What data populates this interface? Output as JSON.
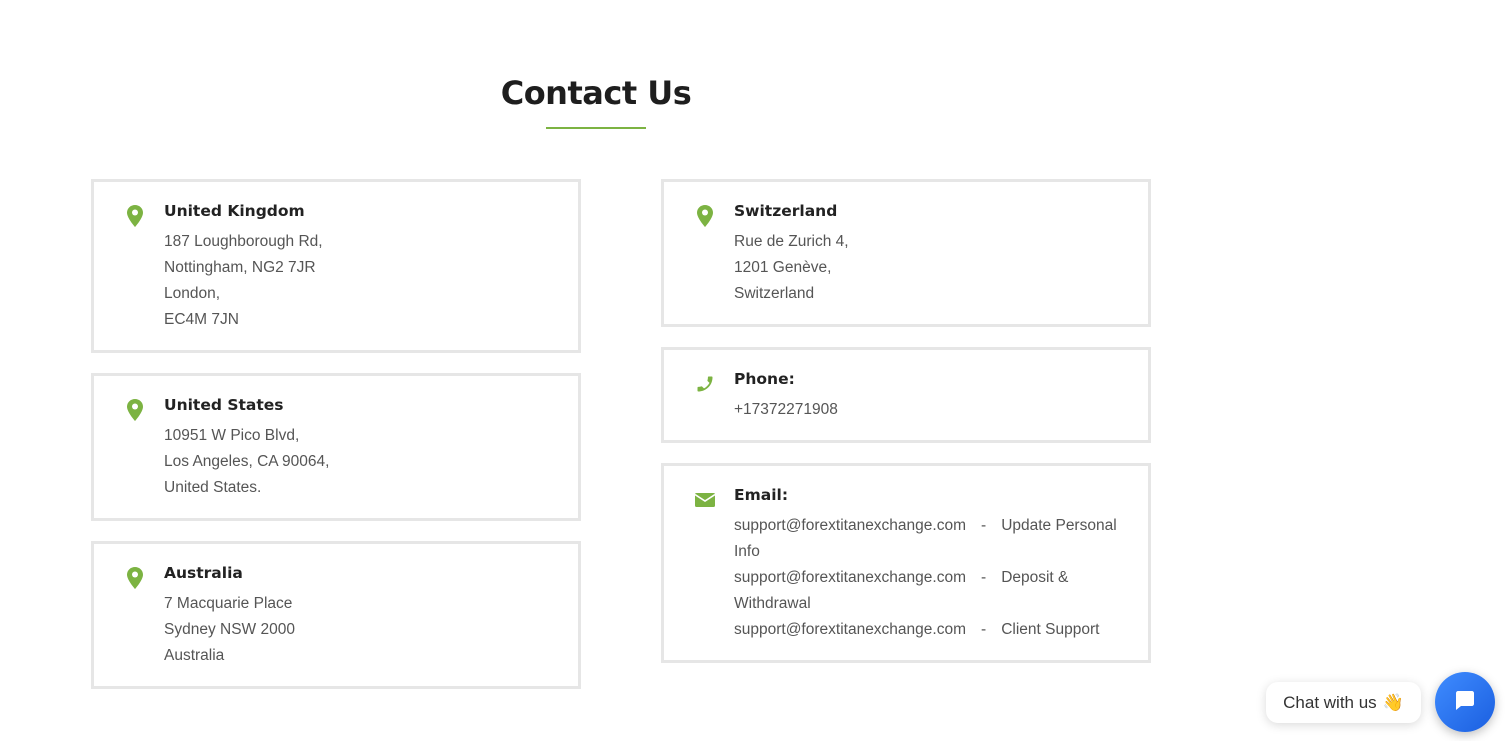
{
  "page": {
    "heading": "Contact Us",
    "accent_color": "#7cb342"
  },
  "cards": {
    "uk": {
      "icon": "map-pin-icon",
      "title": "United Kingdom",
      "lines": [
        "187 Loughborough Rd,",
        "Nottingham, NG2 7JR",
        "London,",
        "EC4M 7JN"
      ]
    },
    "us": {
      "icon": "map-pin-icon",
      "title": "United States",
      "lines": [
        "10951 W Pico Blvd,",
        "Los Angeles, CA 90064,",
        "United States."
      ]
    },
    "au": {
      "icon": "map-pin-icon",
      "title": "Australia",
      "lines": [
        "7 Macquarie Place",
        "Sydney NSW 2000",
        "Australia"
      ]
    },
    "ch": {
      "icon": "map-pin-icon",
      "title": "Switzerland",
      "lines": [
        "Rue de Zurich 4,",
        "1201 Genève,",
        "Switzerland"
      ]
    },
    "phone": {
      "icon": "phone-icon",
      "title": "Phone:",
      "value": "+17372271908"
    },
    "email": {
      "icon": "envelope-icon",
      "title": "Email:",
      "rows": [
        {
          "address": "support@forextitanexchange.com",
          "separator": "-",
          "purpose_line1": "Update Personal",
          "purpose_line2": "Info"
        },
        {
          "address": "support@forextitanexchange.com",
          "separator": "-",
          "purpose_line1": "Deposit &",
          "purpose_line2": "Withdrawal"
        },
        {
          "address": "support@forextitanexchange.com",
          "separator": "-",
          "purpose_line1": "Client Support",
          "purpose_line2": ""
        }
      ]
    }
  },
  "chat": {
    "label": "Chat with us",
    "emoji": "👋",
    "button_icon": "chat-icon",
    "button_color": "#1b5fe0"
  }
}
